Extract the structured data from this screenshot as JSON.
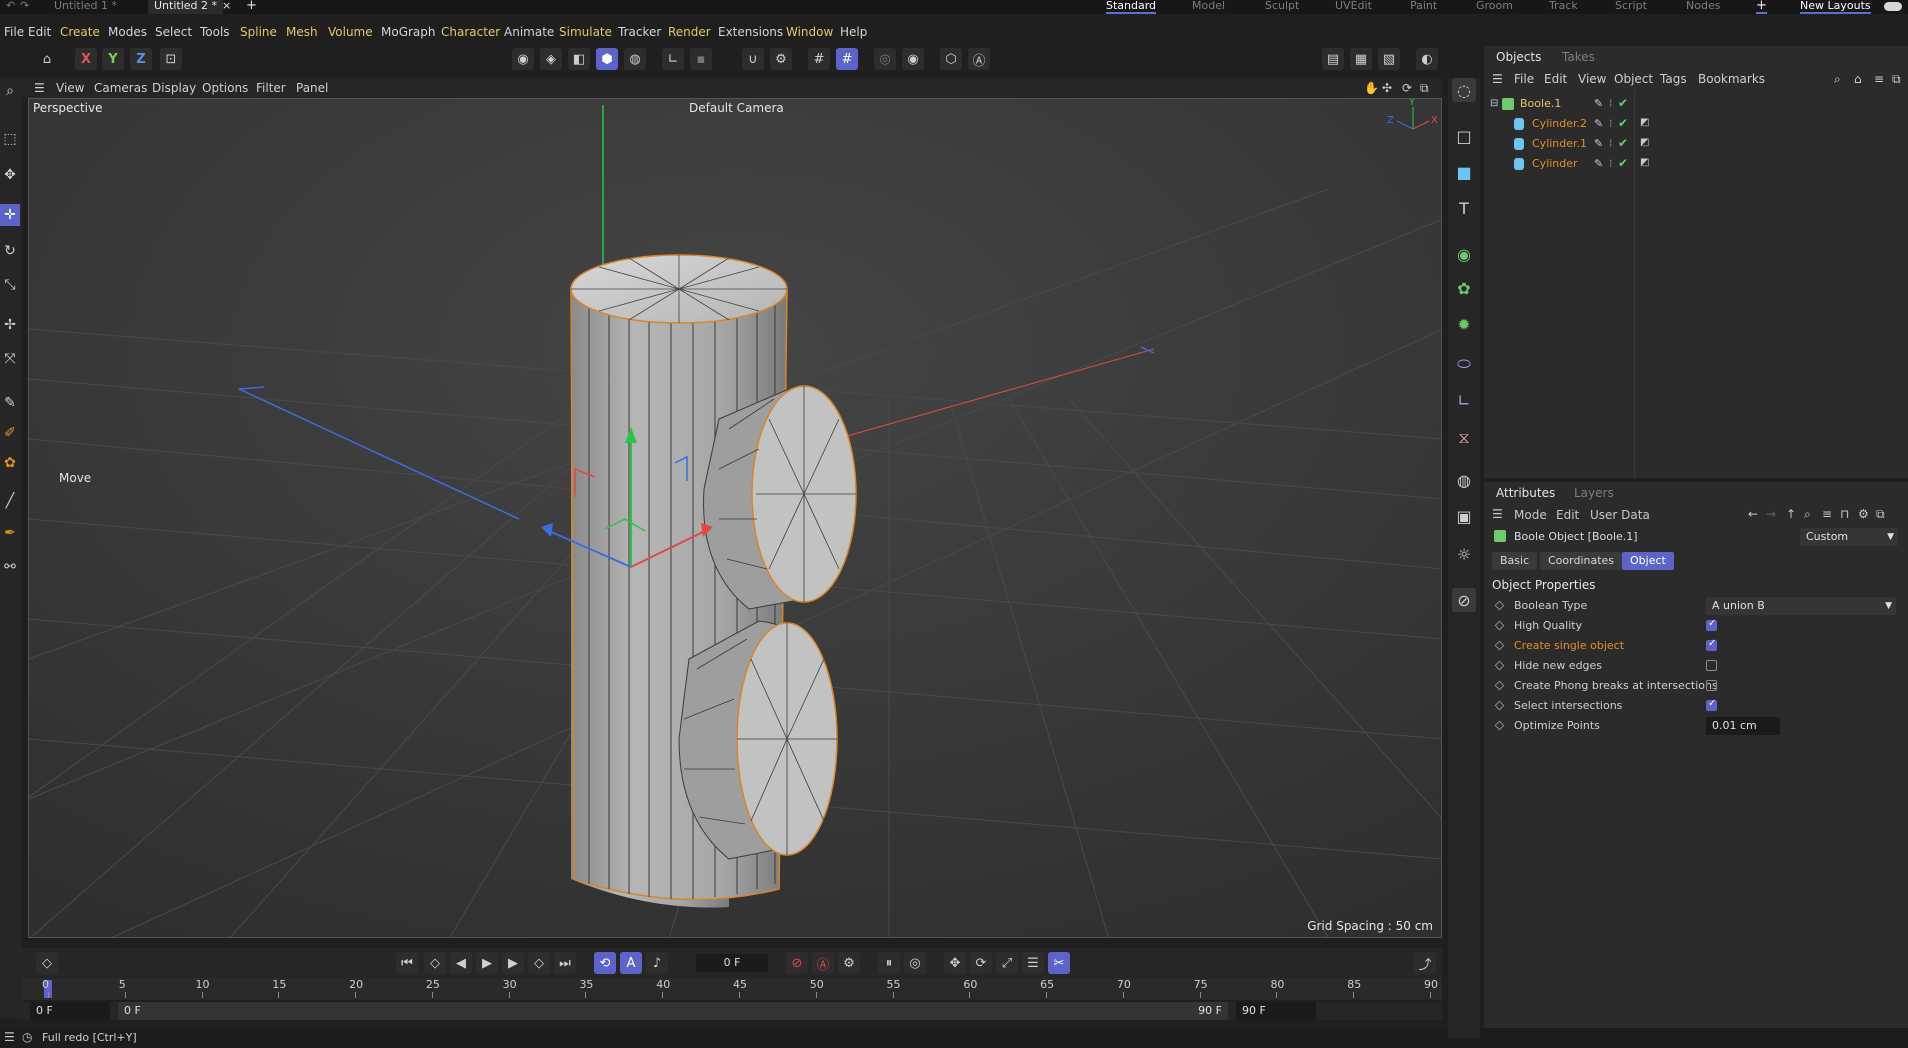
{
  "top": {
    "tabs": [
      "Untitled 1 *",
      "Untitled 2 *"
    ],
    "layouts": [
      "Standard",
      "Model",
      "Sculpt",
      "UVEdit",
      "Paint",
      "Groom",
      "Track",
      "Script",
      "Nodes"
    ],
    "new_layouts": "New Layouts"
  },
  "menu": [
    "File",
    "Edit",
    "Create",
    "Modes",
    "Select",
    "Tools",
    "Spline",
    "Mesh",
    "Volume",
    "MoGraph",
    "Character",
    "Animate",
    "Simulate",
    "Tracker",
    "Render",
    "Extensions",
    "Window",
    "Help"
  ],
  "axis_buttons": [
    "X",
    "Y",
    "Z"
  ],
  "viewport": {
    "menu": [
      "View",
      "Cameras",
      "Display",
      "Options",
      "Filter",
      "Panel"
    ],
    "label": "Perspective",
    "camera": "Default Camera",
    "grid_spacing": "Grid Spacing : 50 cm",
    "tool_label": "Move",
    "gizmo_axes": [
      "Y",
      "Z",
      "X"
    ]
  },
  "timeline": {
    "frame_field": "0 F",
    "ticks": [
      "0",
      "5",
      "10",
      "15",
      "20",
      "25",
      "30",
      "35",
      "40",
      "45",
      "50",
      "55",
      "60",
      "65",
      "70",
      "75",
      "80",
      "85",
      "90"
    ],
    "start_field": "0 F",
    "range_start": "0 F",
    "range_end": "90 F",
    "end_field": "90 F"
  },
  "status": "Full redo [Ctrl+Y]",
  "objects": {
    "tabs": [
      "Objects",
      "Takes"
    ],
    "menu": [
      "File",
      "Edit",
      "View",
      "Object",
      "Tags",
      "Bookmarks"
    ],
    "items": [
      {
        "name": "Boole.1",
        "color": "#e8c56a"
      },
      {
        "name": "Cylinder.2",
        "color": "#e0902a"
      },
      {
        "name": "Cylinder.1",
        "color": "#e0902a"
      },
      {
        "name": "Cylinder",
        "color": "#e0902a"
      }
    ]
  },
  "attributes": {
    "tabs": [
      "Attributes",
      "Layers"
    ],
    "menu": [
      "Mode",
      "Edit",
      "User Data"
    ],
    "object_title": "Boole Object [Boole.1]",
    "preset": "Custom",
    "subtabs": [
      "Basic",
      "Coordinates",
      "Object"
    ],
    "section": "Object Properties",
    "props": [
      {
        "label": "Boolean Type",
        "type": "select",
        "value": "A union B"
      },
      {
        "label": "High Quality",
        "type": "check",
        "checked": true
      },
      {
        "label": "Create single object",
        "type": "check",
        "checked": true,
        "highlight": true
      },
      {
        "label": "Hide new edges",
        "type": "check",
        "checked": false
      },
      {
        "label": "Create Phong breaks at intersections",
        "type": "check",
        "checked": false
      },
      {
        "label": "Select intersections",
        "type": "check",
        "checked": true
      },
      {
        "label": "Optimize Points",
        "type": "field",
        "value": "0.01 cm"
      }
    ]
  },
  "colors": {
    "accent": "#5c63c9",
    "gold": "#e8c56a",
    "orange": "#e0902a"
  }
}
